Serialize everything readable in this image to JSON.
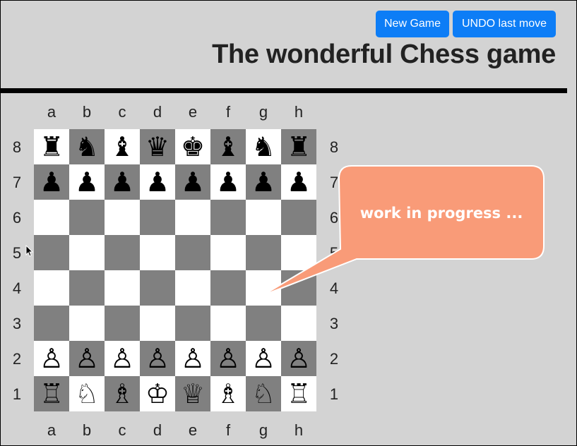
{
  "header": {
    "new_game_label": "New Game",
    "undo_label": "UNDO last move",
    "title": "The wonderful Chess game"
  },
  "board": {
    "files": [
      "a",
      "b",
      "c",
      "d",
      "e",
      "f",
      "g",
      "h"
    ],
    "ranks": [
      "8",
      "7",
      "6",
      "5",
      "4",
      "3",
      "2",
      "1"
    ],
    "rows": [
      [
        "♜",
        "♞",
        "♝",
        "♛",
        "♚",
        "♝",
        "♞",
        "♜"
      ],
      [
        "♟",
        "♟",
        "♟",
        "♟",
        "♟",
        "♟",
        "♟",
        "♟"
      ],
      [
        "",
        "",
        "",
        "",
        "",
        "",
        "",
        ""
      ],
      [
        "",
        "",
        "",
        "",
        "",
        "",
        "",
        ""
      ],
      [
        "",
        "",
        "",
        "",
        "",
        "",
        "",
        ""
      ],
      [
        "",
        "",
        "",
        "",
        "",
        "",
        "",
        ""
      ],
      [
        "♙",
        "♙",
        "♙",
        "♙",
        "♙",
        "♙",
        "♙",
        "♙"
      ],
      [
        "♖",
        "♘",
        "♗",
        "♔",
        "♕",
        "♗",
        "♘",
        "♖"
      ]
    ],
    "light_color": "#ffffff",
    "dark_color": "#808080"
  },
  "bubble": {
    "text": "work in progress ...",
    "fill": "#f99b78"
  },
  "colors": {
    "background": "#d3d3d3",
    "button": "#0d7df6"
  }
}
